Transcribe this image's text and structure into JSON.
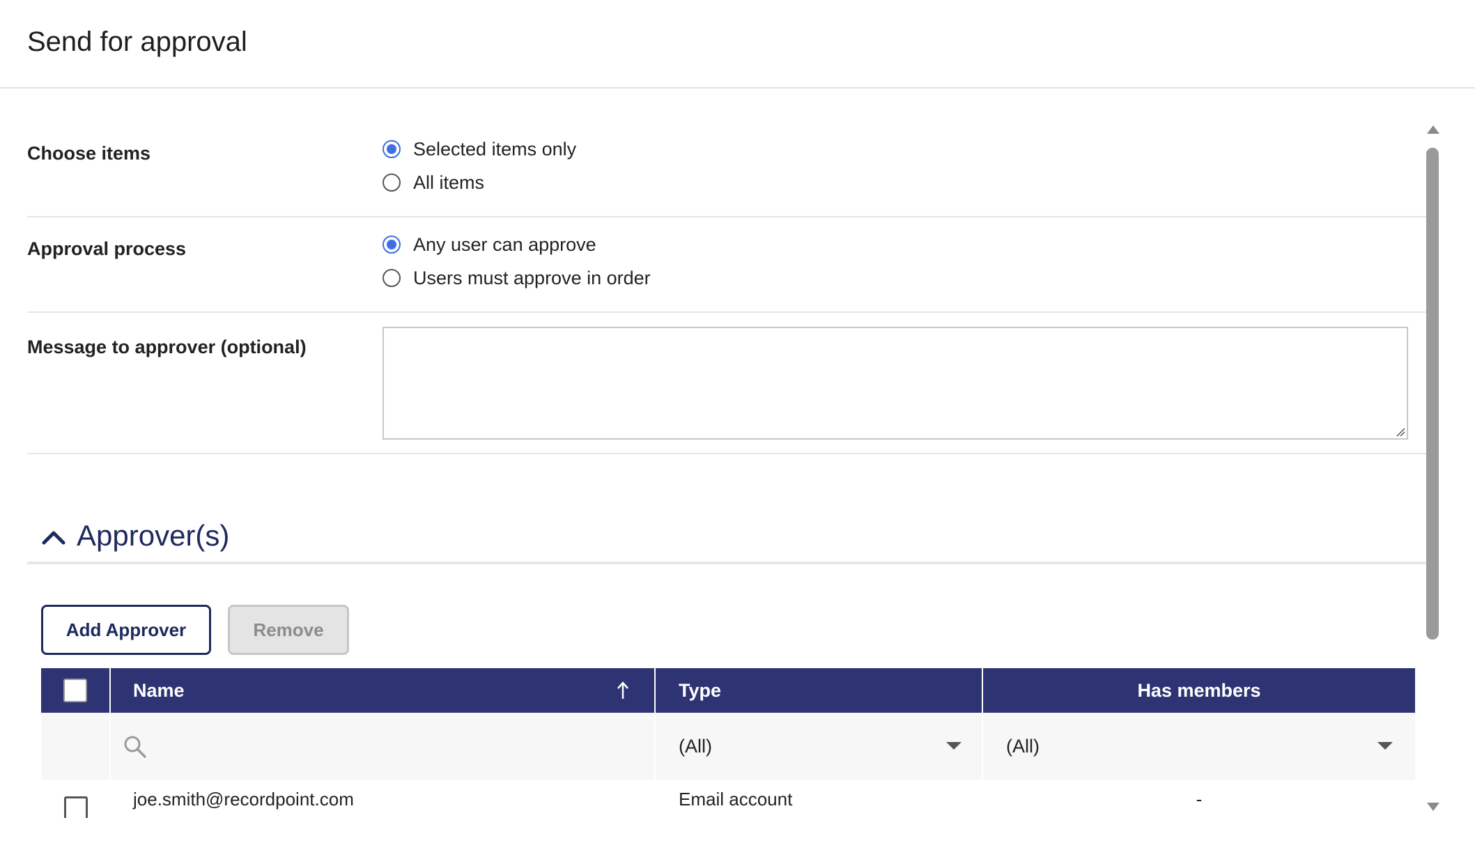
{
  "dialog": {
    "title": "Send for approval"
  },
  "choose_items": {
    "label": "Choose items",
    "options": [
      {
        "label": "Selected items only",
        "checked": true
      },
      {
        "label": "All items",
        "checked": false
      }
    ]
  },
  "approval_process": {
    "label": "Approval process",
    "options": [
      {
        "label": "Any user can approve",
        "checked": true
      },
      {
        "label": "Users must approve in order",
        "checked": false
      }
    ]
  },
  "message": {
    "label": "Message to approver (optional)",
    "value": ""
  },
  "approvers": {
    "title": "Approver(s)",
    "add_button": "Add Approver",
    "remove_button": "Remove",
    "columns": {
      "name": "Name",
      "type": "Type",
      "has_members": "Has members"
    },
    "filters": {
      "type": "(All)",
      "has_members": "(All)"
    },
    "rows": [
      {
        "name": "joe.smith@recordpoint.com",
        "type": "Email account",
        "has_members": "-"
      }
    ]
  },
  "colors": {
    "accent": "#3d6fe0",
    "header_bg": "#2e3473",
    "brand_navy": "#1d2a5c"
  }
}
